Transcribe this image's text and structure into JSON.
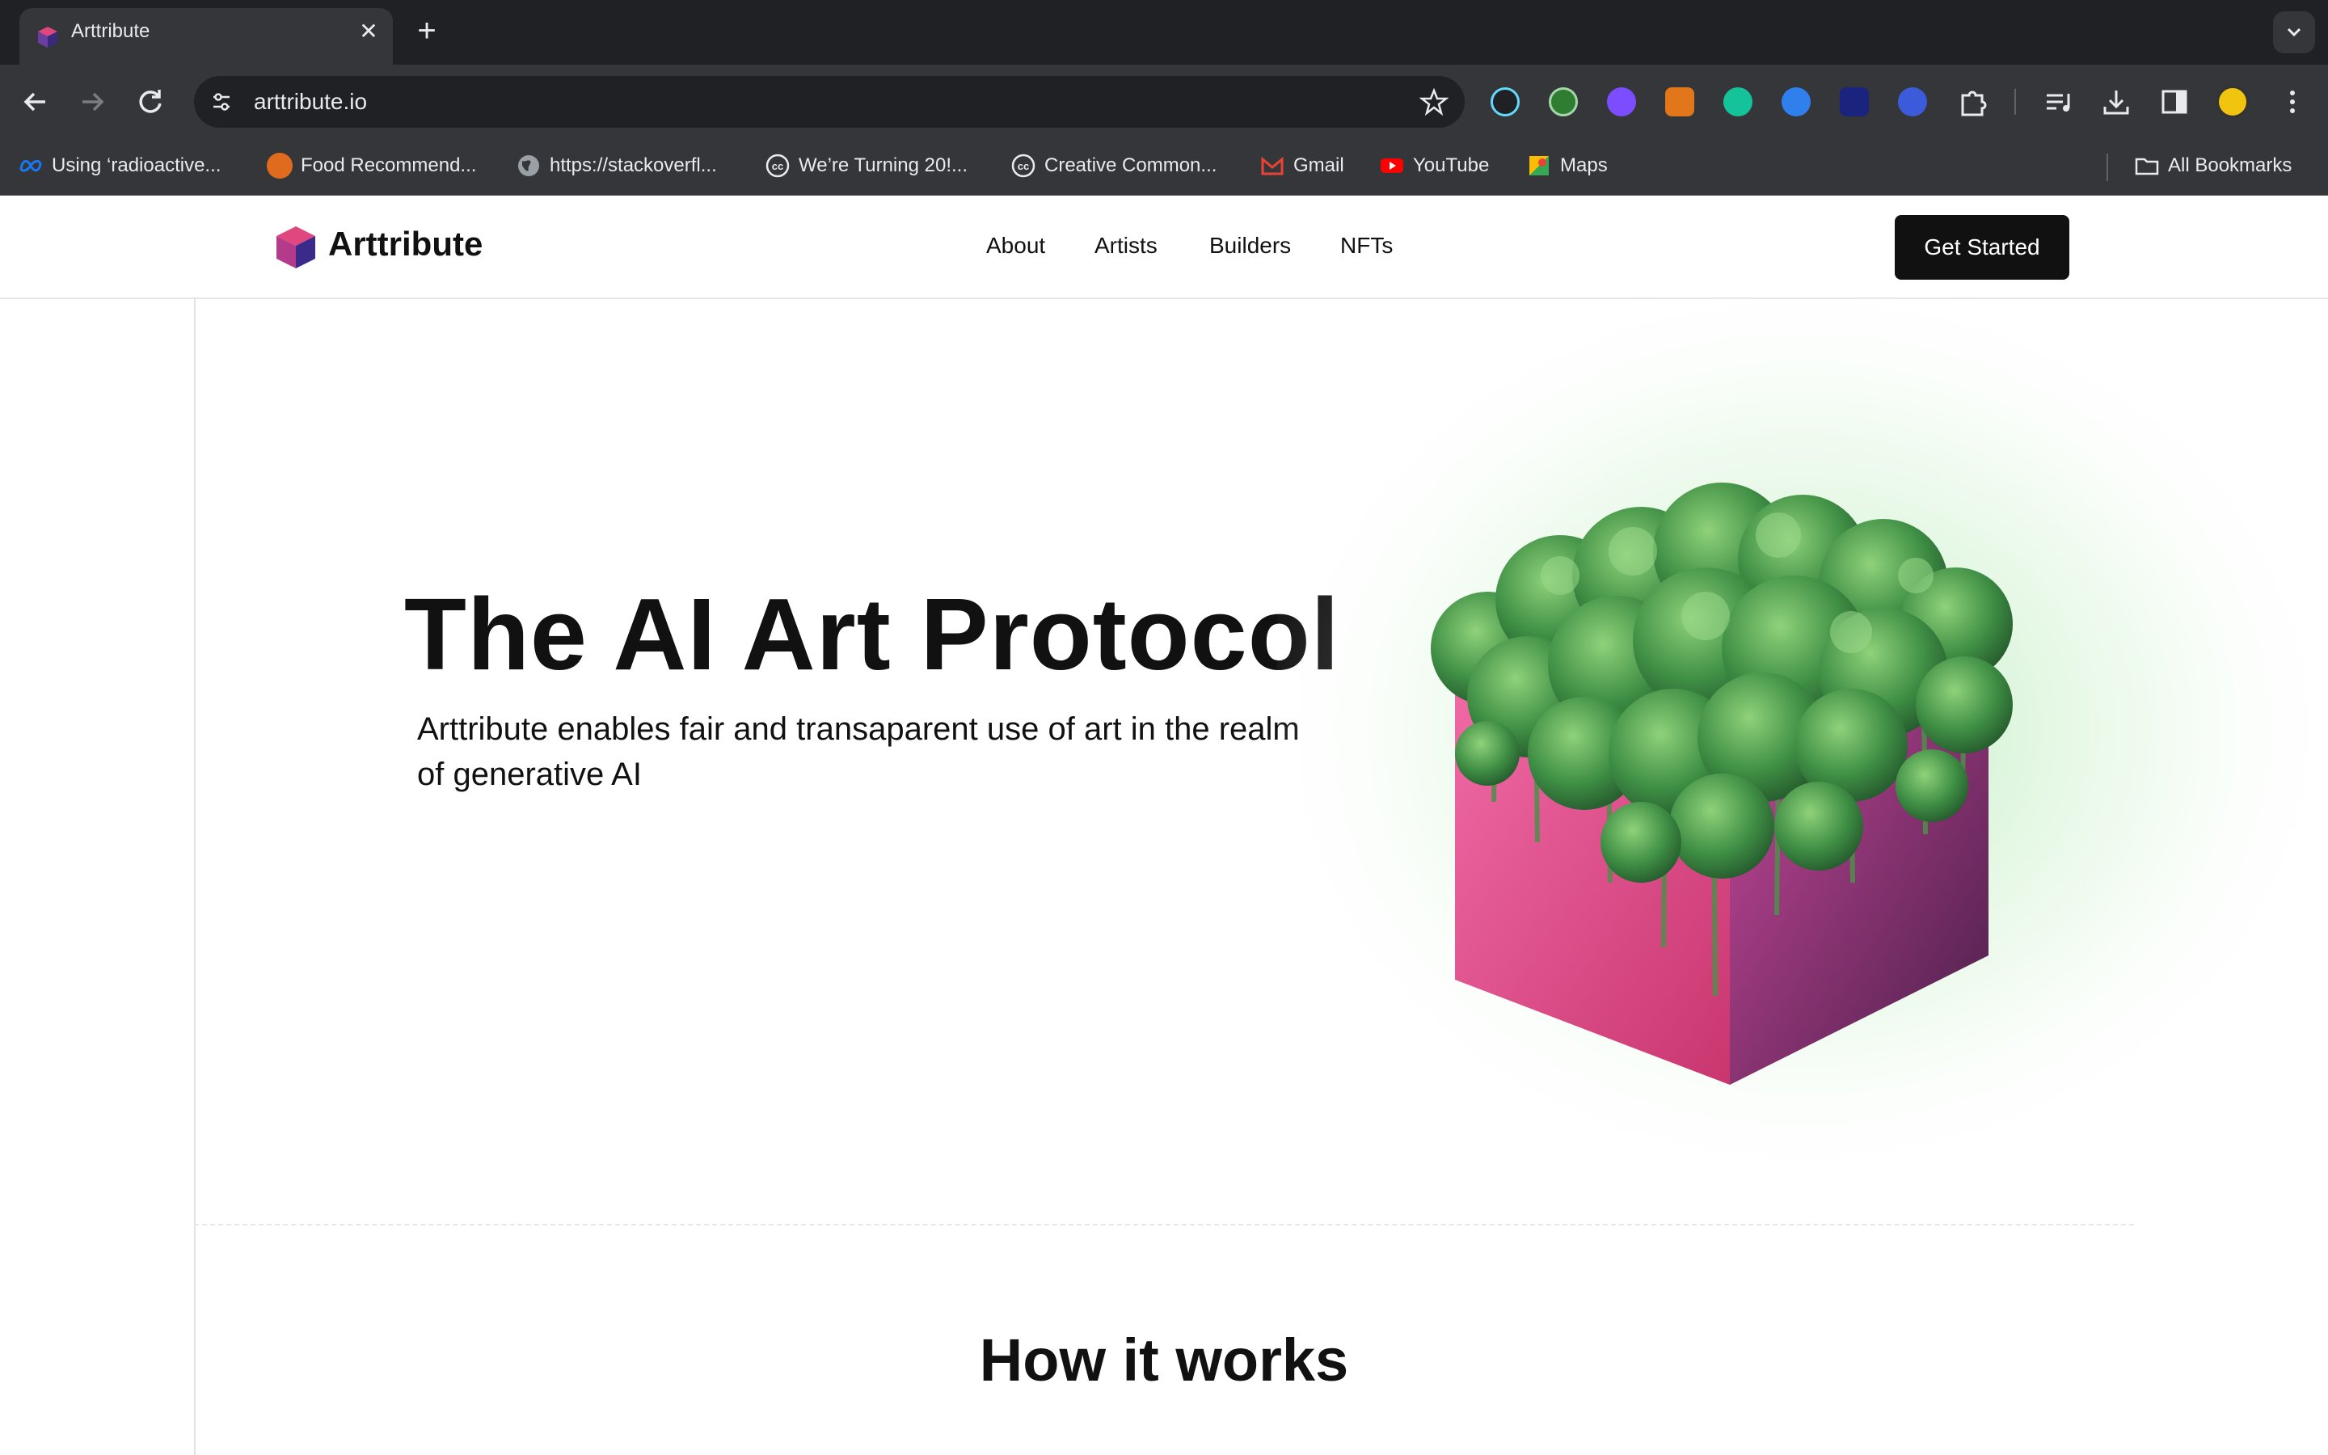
{
  "browser": {
    "tab_title": "Arttribute",
    "tab_close": "✕",
    "new_tab": "+",
    "url": "arttribute.io",
    "bookmarks": [
      {
        "label": "Using ‘radioactive...",
        "icon": "meta-icon",
        "color": "#1877f2"
      },
      {
        "label": "Food Recommend...",
        "icon": "food-icon",
        "color": "#e06b1f"
      },
      {
        "label": "https://stackoverfl...",
        "icon": "globe-icon",
        "color": "#9aa0a6"
      },
      {
        "label": "We’re Turning 20!...",
        "icon": "cc-icon",
        "color": "#e8eaed"
      },
      {
        "label": "Creative Common...",
        "icon": "cc-icon",
        "color": "#e8eaed"
      },
      {
        "label": "Gmail",
        "icon": "gmail-icon",
        "color": "#ea4335"
      },
      {
        "label": "YouTube",
        "icon": "youtube-icon",
        "color": "#ff0000"
      },
      {
        "label": "Maps",
        "icon": "maps-icon",
        "color": "#34a853"
      }
    ],
    "all_bookmarks": "All Bookmarks",
    "extension_colors": [
      "#61dafb",
      "#4caf50",
      "#7b4dff",
      "#e2761b",
      "#15c39a",
      "#2f80ed",
      "#1a237e",
      "#3b5bdb"
    ]
  },
  "site": {
    "brand": "Arttribute",
    "nav": [
      "About",
      "Artists",
      "Builders",
      "NFTs"
    ],
    "cta": "Get Started",
    "hero_title": "The AI Art Protocol",
    "hero_subtitle": "Arttribute enables fair and transaparent use of art in the realm of generative AI",
    "section_title": "How it works",
    "accent_pink": "#e0477e",
    "accent_purple": "#6b3fa0",
    "foliage_green": "#3f8f45"
  }
}
